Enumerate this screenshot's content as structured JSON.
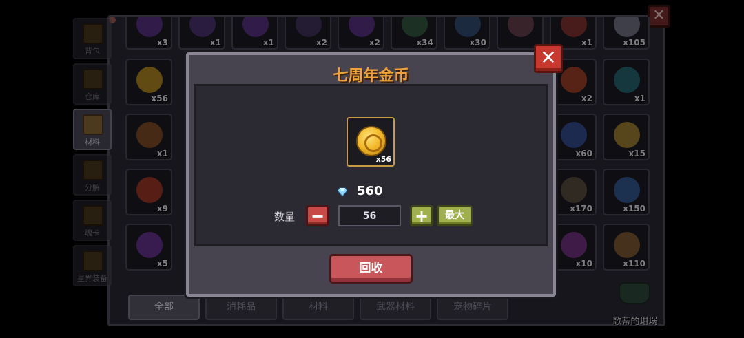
{
  "inventory": {
    "side_tabs": [
      {
        "label": "背包",
        "active": false
      },
      {
        "label": "仓库",
        "active": false
      },
      {
        "label": "材料",
        "active": true
      },
      {
        "label": "分解",
        "active": false
      },
      {
        "label": "魂卡",
        "active": false
      },
      {
        "label": "星界装备",
        "active": false
      }
    ],
    "slots_row1": [
      "x3",
      "x1",
      "x1",
      "x2",
      "x2",
      "x34",
      "x30",
      "",
      "x1",
      "x105"
    ],
    "slots_left": [
      "x56",
      "x1",
      "x9",
      "x5"
    ],
    "slots_right": [
      [
        "x2",
        "x1"
      ],
      [
        "x60",
        "x15"
      ],
      [
        "x170",
        "x150"
      ],
      [
        "x10",
        "x110"
      ]
    ],
    "bottom_tabs": [
      {
        "label": "全部",
        "active": true
      },
      {
        "label": "消耗品",
        "active": false
      },
      {
        "label": "材料",
        "active": false
      },
      {
        "label": "武器材料",
        "active": false
      },
      {
        "label": "宠物碎片",
        "active": false
      }
    ],
    "cauldron_label": "歌蒂的坩埚"
  },
  "modal": {
    "title": "七周年金币",
    "item_count": "x56",
    "price": "560",
    "quantity_label": "数量",
    "quantity_value": "56",
    "max_label": "最大",
    "recycle_label": "回收",
    "minus_label": "−",
    "plus_label": "+",
    "close_label": "✕"
  },
  "colors": {
    "title_orange": "#f0a23a",
    "close_red": "#c9382f",
    "recycle_red": "#c9565a",
    "plus_green": "#a0b04c"
  }
}
